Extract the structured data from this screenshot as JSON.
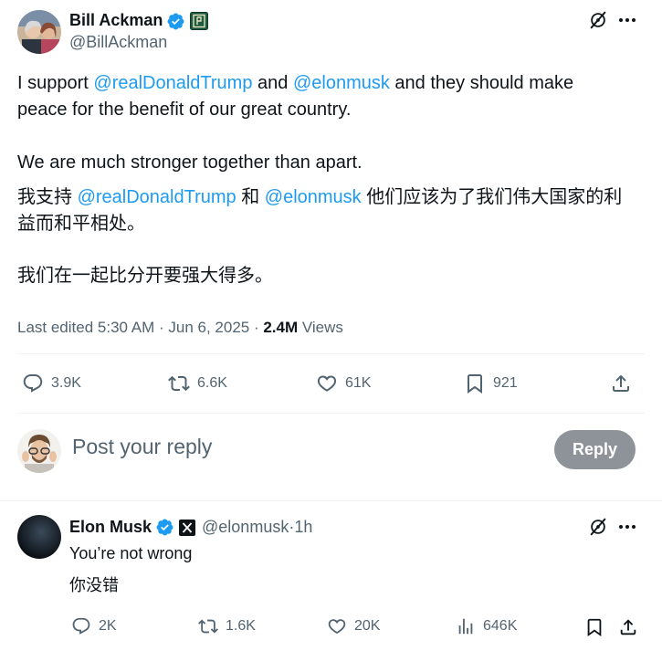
{
  "tweet": {
    "author_name": "Bill Ackman",
    "author_handle": "@BillAckman",
    "line1_pre": "I support ",
    "mention1": "@realDonaldTrump",
    "line1_mid": " and ",
    "mention2": "@elonmusk",
    "line1_post": " and they should make",
    "line2": "peace for the benefit of our great country.",
    "line3": "We are much stronger together than apart.",
    "zh1_pre": "我支持 ",
    "zh_mention1": "@realDonaldTrump",
    "zh1_mid": " 和 ",
    "zh_mention2": "@elonmusk",
    "zh1_post": " 他们应该为了我们伟大国家的利",
    "zh2": "益而和平相处。",
    "zh3": "我们在一起比分开要强大得多。",
    "edited_time": "Last edited 5:30 AM · Jun 6, 2025 · ",
    "views_count": "2.4M",
    "views_label": " Views",
    "stats": {
      "replies": "3.9K",
      "reposts": "6.6K",
      "likes": "61K",
      "bookmarks": "921"
    }
  },
  "composer": {
    "placeholder": "Post your reply",
    "reply_button": "Reply"
  },
  "reply": {
    "author_name": "Elon Musk",
    "author_handle": "@elonmusk",
    "separator": " · ",
    "time": "1h",
    "text1": "You’re not wrong",
    "text2": "你没错",
    "stats": {
      "replies": "2K",
      "reposts": "1.6K",
      "likes": "20K",
      "views": "646K"
    }
  },
  "colors": {
    "accent": "#1d9bf0",
    "secondary_text": "#536471",
    "reply_button_bg": "#8d9399"
  }
}
